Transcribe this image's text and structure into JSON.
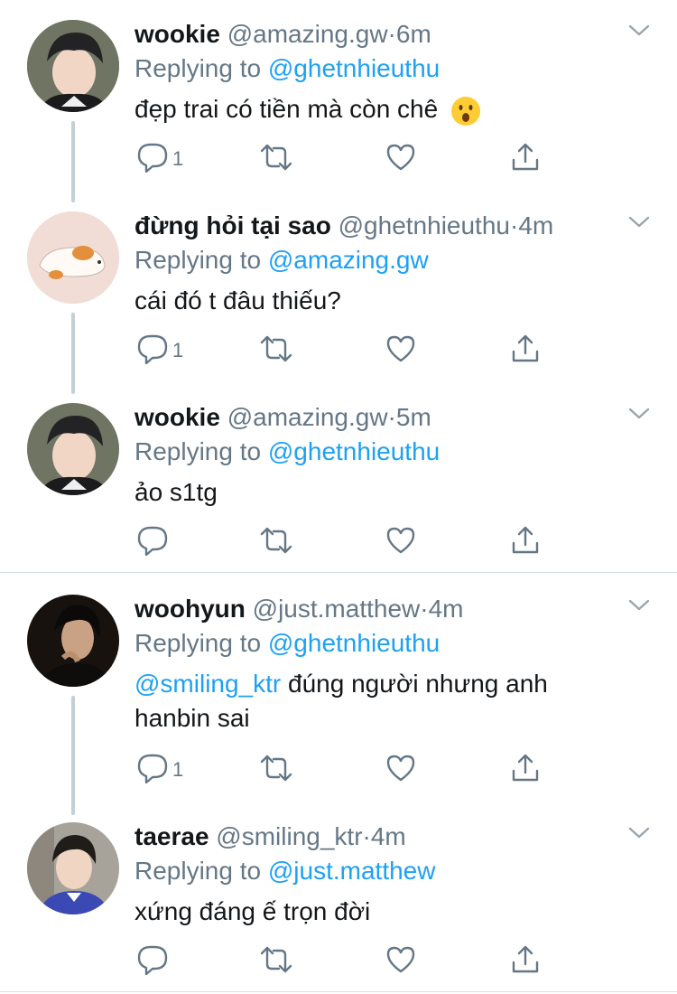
{
  "tweets": [
    {
      "name": "wookie",
      "handle": "@amazing.gw",
      "dot": "·",
      "time": "6m",
      "replying_prefix": "Replying to",
      "replying_to": "@ghetnhieuthu",
      "text": "đẹp trai có tiền mà còn chê",
      "emoji": "hushed-face-emoji",
      "reply_count": "1"
    },
    {
      "name": "đừng hỏi tại sao",
      "handle": "@ghetnhieuthu",
      "dot": "·",
      "time": "4m",
      "replying_prefix": "Replying to",
      "replying_to": "@amazing.gw",
      "text": "cái đó t đâu thiếu?",
      "reply_count": "1"
    },
    {
      "name": "wookie",
      "handle": "@amazing.gw",
      "dot": "·",
      "time": "5m",
      "replying_prefix": "Replying to",
      "replying_to": "@ghetnhieuthu",
      "text": "ảo s1tg",
      "reply_count": ""
    },
    {
      "name": "woohyun",
      "handle": "@just.matthew",
      "dot": "·",
      "time": "4m",
      "replying_prefix": "Replying to",
      "replying_to": "@ghetnhieuthu",
      "mention": "@smiling_ktr",
      "text": " đúng người nhưng anh hanbin sai",
      "reply_count": "1"
    },
    {
      "name": "taerae",
      "handle": "@smiling_ktr",
      "dot": "·",
      "time": "4m",
      "replying_prefix": "Replying to",
      "replying_to": "@just.matthew",
      "text": "xứng đáng ế trọn đời",
      "reply_count": ""
    }
  ],
  "icons": {
    "reply": "reply-icon",
    "retweet": "retweet-icon",
    "like": "heart-icon",
    "share": "share-icon",
    "menu": "chevron-down-icon"
  },
  "colors": {
    "link": "#1da1f2",
    "secondary_text": "#657786",
    "thread_line": "#c4cfd6"
  }
}
